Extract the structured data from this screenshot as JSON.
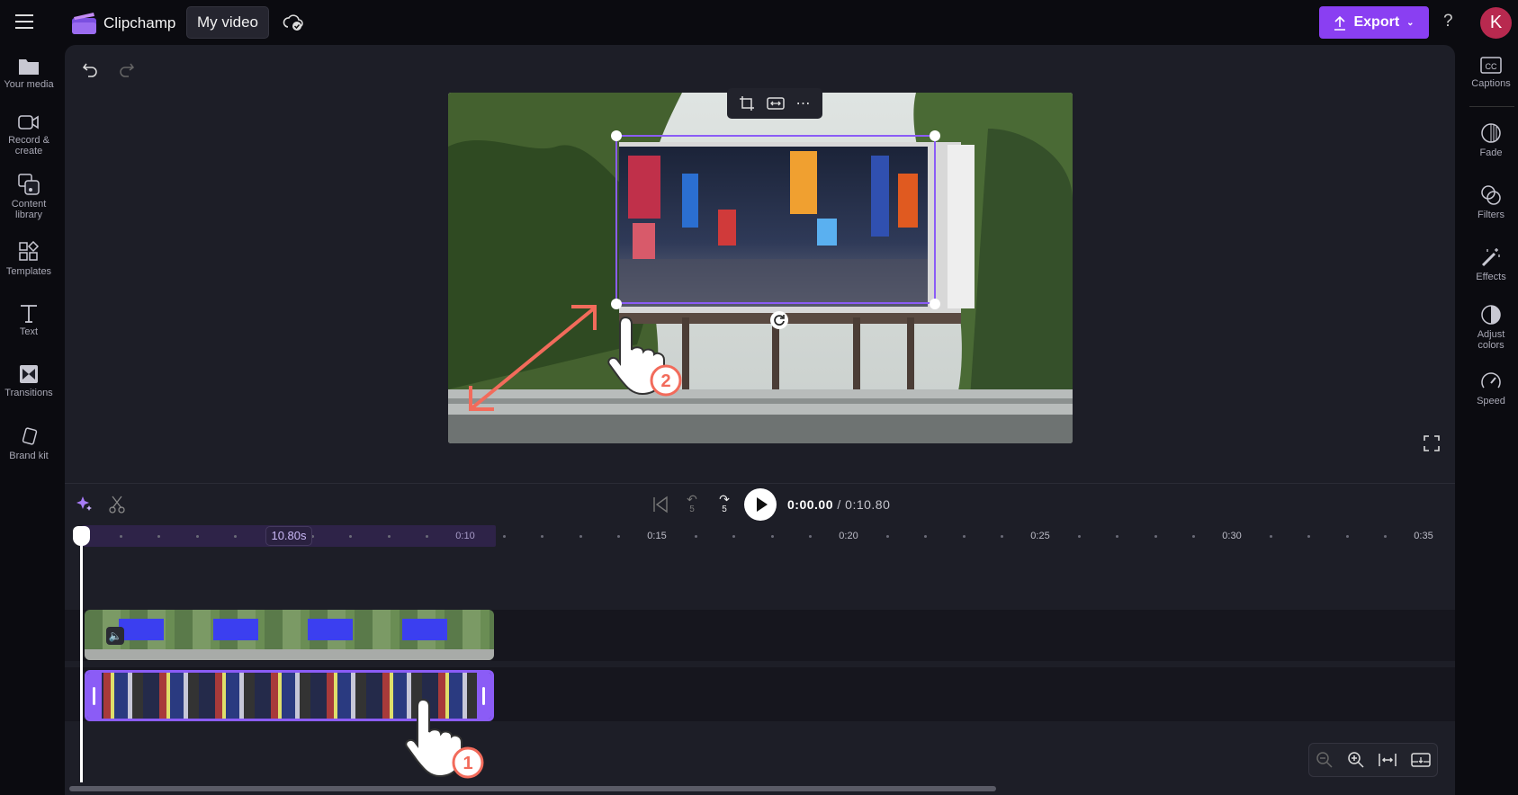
{
  "app": {
    "name": "Clipchamp",
    "project_title": "My video",
    "export_label": "Export",
    "help_label": "?",
    "avatar_initial": "K"
  },
  "left_rail": [
    {
      "label": "Your media",
      "icon": "folder-icon"
    },
    {
      "label": "Record &",
      "label2": "create",
      "icon": "camera-icon"
    },
    {
      "label": "Content",
      "label2": "library",
      "icon": "content-library-icon"
    },
    {
      "label": "Templates",
      "icon": "templates-icon"
    },
    {
      "label": "Text",
      "icon": "text-icon"
    },
    {
      "label": "Transitions",
      "icon": "transitions-icon"
    },
    {
      "label": "Brand kit",
      "icon": "brand-kit-icon"
    }
  ],
  "right_rail": [
    {
      "label": "Captions",
      "icon": "captions-icon"
    },
    {
      "label": "Fade",
      "icon": "fade-icon"
    },
    {
      "label": "Filters",
      "icon": "filters-icon"
    },
    {
      "label": "Effects",
      "icon": "effects-icon"
    },
    {
      "label": "Adjust",
      "label2": "colors",
      "icon": "adjust-colors-icon"
    },
    {
      "label": "Speed",
      "icon": "speed-icon"
    }
  ],
  "playback": {
    "current": "0:00.00",
    "total": "/ 0:10.80",
    "skip_back": "5",
    "skip_fwd": "5"
  },
  "timeline": {
    "duration_badge": "10.80s",
    "ticks": [
      "0:10",
      "0:15",
      "0:20",
      "0:25",
      "0:30",
      "0:35"
    ]
  },
  "annotations": {
    "step1": "1",
    "step2": "2"
  },
  "colors": {
    "accent": "#8a3ff2",
    "avatar": "#b8294f",
    "arrow": "#f26b5b"
  }
}
